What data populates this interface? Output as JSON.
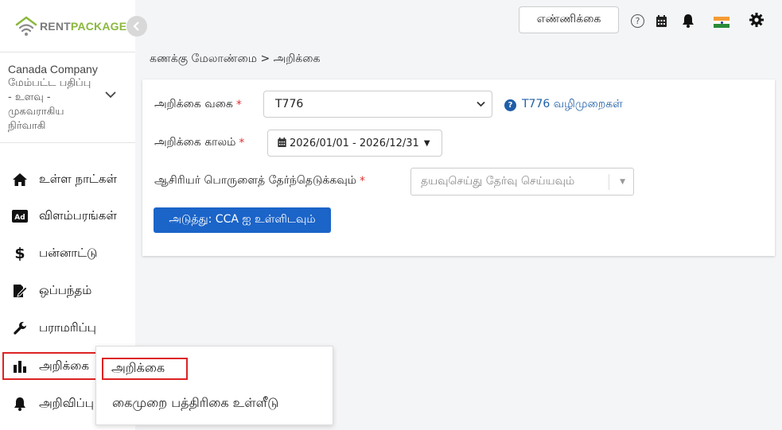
{
  "brand": {
    "rent": "RENT",
    "package": "PACKAGE",
    "green": "#8ab83d",
    "gray": "#7a7a7a"
  },
  "sidebar": {
    "company_name": "Canada Company",
    "company_lines": [
      "மேம்பட்ட பதிப்பு",
      "- உளவு -",
      "முகவராகிய",
      "நிர்வாகி"
    ],
    "items": [
      {
        "label": "உள்ள நாட்கள்",
        "icon": "home-icon"
      },
      {
        "label": "விளம்பரங்கள்",
        "icon": "ad-icon"
      },
      {
        "label": "பன்னாட்டு",
        "icon": "dollar-icon"
      },
      {
        "label": "ஒப்பந்தம்",
        "icon": "contract-icon"
      },
      {
        "label": "பராமரிப்பு",
        "icon": "wrench-icon"
      },
      {
        "label": "அறிக்கை",
        "icon": "bar-chart-icon"
      },
      {
        "label": "அறிவிப்பு",
        "icon": "bell-icon"
      }
    ]
  },
  "topbar": {
    "count_button": "எண்ணிக்கை",
    "help": "?",
    "icons": [
      "help-icon",
      "calendar-icon",
      "bell-icon",
      "india-flag-icon",
      "gear-icon"
    ]
  },
  "breadcrumb": "கணக்கு மேலாண்மை > அறிக்கை",
  "form": {
    "report_type_label": "அறிக்கை வகை",
    "report_type_value": "T776",
    "help_link": "T776 வழிமுறைகள்",
    "period_label": "அறிக்கை காலம்",
    "period_value": "2026/01/01 - 2026/12/31",
    "owner_label": "ஆசிரியர் பொருளைத் தேர்ந்தெடுக்கவும்",
    "owner_placeholder": "தயவுசெய்து தேர்வு செய்யவும்",
    "required_mark": "*",
    "next_button": "அடுத்து: CCA ஐ உள்ளிடவும்"
  },
  "popup": {
    "items": [
      "அறிக்கை",
      "கைமுறை பத்திரிகை உள்ளீடு"
    ]
  },
  "colors": {
    "primary": "#1b64c8",
    "link": "#1f5fa8",
    "required": "#d33",
    "highlight": "#d22"
  }
}
